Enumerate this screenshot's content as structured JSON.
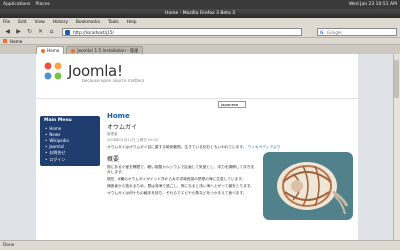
{
  "top_panel": {
    "applications": "Applications",
    "places": "Places",
    "clock": "Wed Jan 23  10:51 AM"
  },
  "window": {
    "title": "Home - Mozilla Firefox 3 Beta 3"
  },
  "menu": [
    "File",
    "Edit",
    "View",
    "History",
    "Bookmarks",
    "Tools",
    "Help"
  ],
  "nav": {
    "url": "http://localhost/j15/",
    "search_placeholder": "Google"
  },
  "bookmarks": {
    "label": "Home"
  },
  "tabs": [
    {
      "label": "Home"
    },
    {
      "label": "Joomla! 1.5 Installation - 管理"
    }
  ],
  "site": {
    "logo_text": "Joomla!",
    "tagline": "because open source matters",
    "language_select": "Japanese",
    "sidebar": {
      "title": "Main Menu",
      "items": [
        "Home",
        "News",
        "Wikipedia",
        "Joomla!",
        "お問合せ",
        "ログイン"
      ]
    },
    "article": {
      "page_heading": "Home",
      "title": "オウムガイ",
      "meta_author": "管理者",
      "meta_date": "2008年01月12日 土曜日 09:30",
      "intro": "オウムガイはオウムガイ目に属する軟体動物。生きている化石ともいわれています。",
      "intro_link": "ウィキペディアより",
      "section": "概要",
      "paragraphs": [
        "殻にある小室を隔壁で、軽い炭酸カルシウムで区画して気室とし、浮力を調節して浮き沈みします。",
        "現在、6種のオウムガイがインド洋から太平洋南西部の熱帯の海に生息しています。",
        "捕食者から逃れるため、昼は深海で過ごし、夜になると浅い海へ上がって餌をとります。",
        "オウムガイは何十もの触手を持ち、それらでエビや小魚などをつかまえて食べます。"
      ]
    }
  },
  "status": {
    "text": "Done"
  },
  "colors": {
    "sidebar": "#1f3d6e",
    "link": "#135cae",
    "page_bg": "#dfe3e8"
  }
}
